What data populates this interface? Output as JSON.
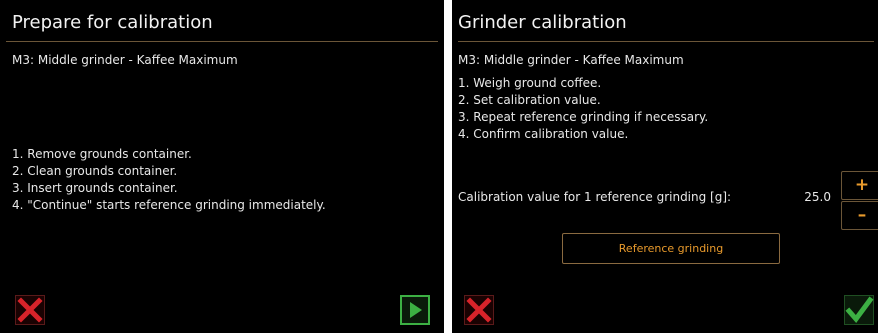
{
  "left_panel": {
    "title": "Prepare for calibration",
    "subtitle": "M3: Middle grinder  - Kaffee Maximum",
    "steps": [
      "1. Remove grounds container.",
      "2. Clean grounds container.",
      "3. Insert grounds container.",
      "4. \"Continue\" starts reference grinding immediately."
    ],
    "cancel_icon": "x-icon",
    "continue_icon": "play-icon"
  },
  "right_panel": {
    "title": "Grinder calibration",
    "subtitle": "M3: Middle grinder  - Kaffee Maximum",
    "steps": [
      "1. Weigh ground coffee.",
      "2. Set calibration value.",
      "3. Repeat reference grinding if necessary.",
      "4. Confirm calibration value."
    ],
    "calibration_label": "Calibration value for 1 reference grinding [g]:",
    "calibration_value": "25.0",
    "plus_label": "+",
    "minus_label": "–",
    "reference_button_label": "Reference grinding",
    "cancel_icon": "x-icon",
    "confirm_icon": "checkmark-icon"
  },
  "colors": {
    "background": "#000000",
    "text": "#e8e8e8",
    "accent": "#e89a2c",
    "border": "#6b5638",
    "cancel": "#d8232a",
    "go": "#3cb043"
  }
}
